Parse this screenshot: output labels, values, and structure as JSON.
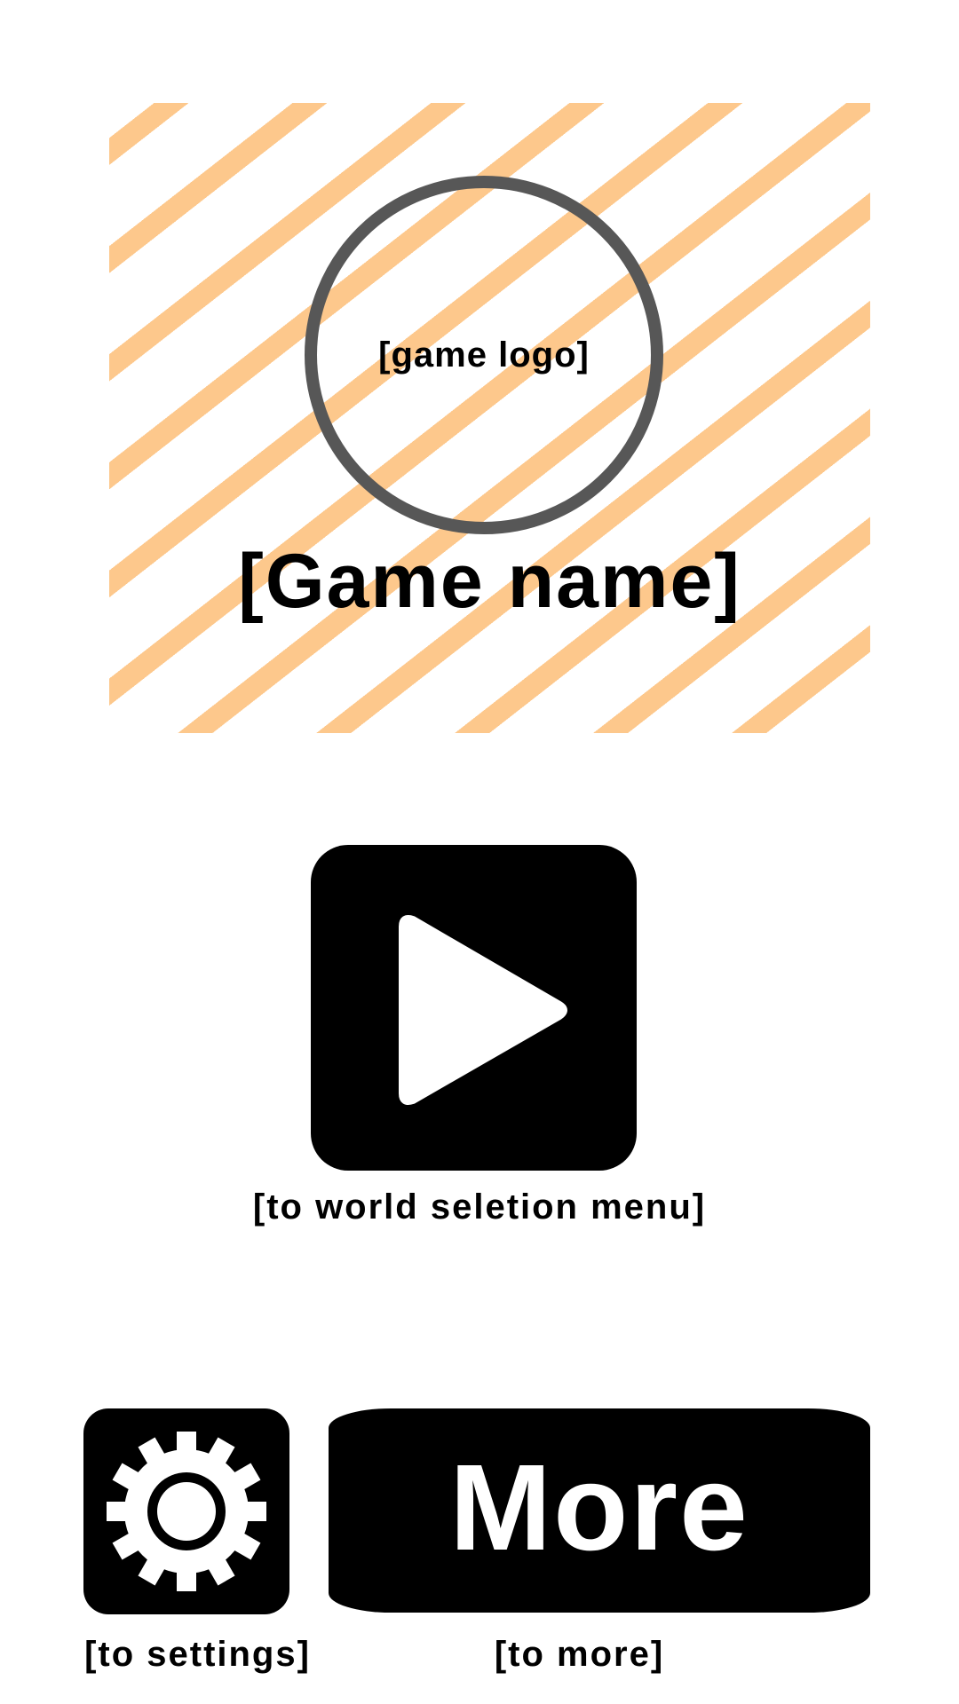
{
  "hero": {
    "logo_label": "[game logo]",
    "game_name": "[Game name]",
    "stripe_color": "#fdc88c",
    "logo_ring_color": "#575757"
  },
  "play": {
    "icon": "play-icon",
    "caption": "[to world seletion menu]"
  },
  "settings": {
    "icon": "gear-icon",
    "caption": "[to settings]"
  },
  "more": {
    "label": "More",
    "caption": "[to more]"
  },
  "colors": {
    "button_bg": "#000000",
    "icon_fg": "#ffffff",
    "background": "#ffffff"
  }
}
